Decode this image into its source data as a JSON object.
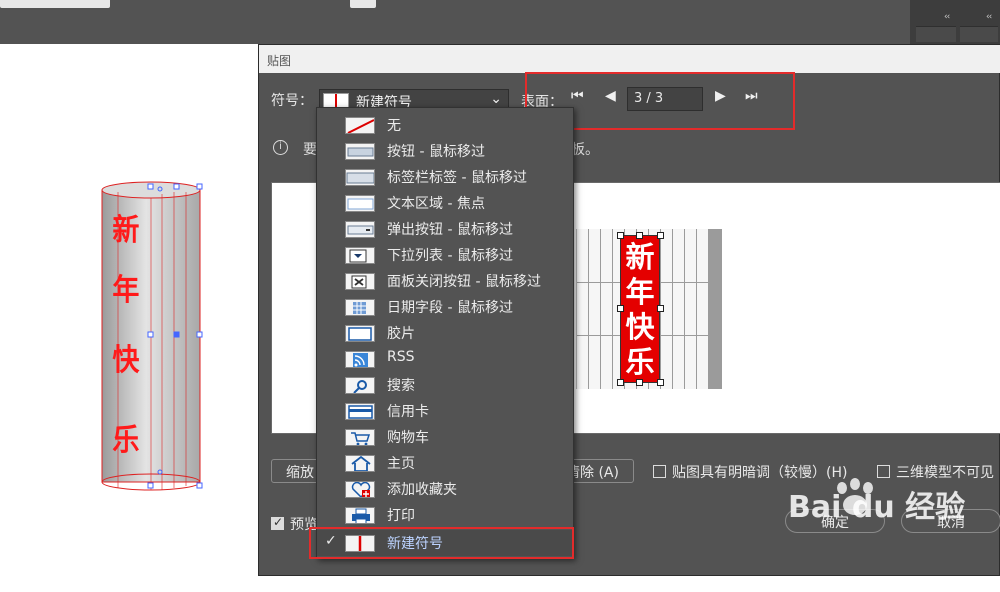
{
  "dialog": {
    "title": "贴图",
    "symbol_label": "符号：",
    "symbol_value": "新建符号",
    "surface_label": "表面：",
    "surface_value": "3 / 3",
    "info_text_start": "要",
    "info_text_end": "板。",
    "scale_button": "缩放",
    "clear_button": "清除 (A)",
    "shading_option": "贴图具有明暗调（较慢）(H)",
    "invisible_option": "三维模型不可见",
    "preview_option": "预览",
    "ok_button": "确定",
    "cancel_button": "取消"
  },
  "symbol_menu": {
    "items": [
      {
        "label": "无",
        "icon": "none-icon"
      },
      {
        "label": "按钮 - 鼠标移过",
        "icon": "button-icon"
      },
      {
        "label": "标签栏标签 - 鼠标移过",
        "icon": "tab-icon"
      },
      {
        "label": "文本区域 - 焦点",
        "icon": "text-area-icon"
      },
      {
        "label": "弹出按钮 - 鼠标移过",
        "icon": "popup-button-icon"
      },
      {
        "label": "下拉列表 - 鼠标移过",
        "icon": "dropdown-list-icon"
      },
      {
        "label": "面板关闭按钮 - 鼠标移过",
        "icon": "panel-close-icon"
      },
      {
        "label": "日期字段 - 鼠标移过",
        "icon": "date-field-icon"
      },
      {
        "label": "胶片",
        "icon": "film-icon"
      },
      {
        "label": "RSS",
        "icon": "rss-icon"
      },
      {
        "label": "搜索",
        "icon": "search-icon"
      },
      {
        "label": "信用卡",
        "icon": "credit-card-icon"
      },
      {
        "label": "购物车",
        "icon": "cart-icon"
      },
      {
        "label": "主页",
        "icon": "home-icon"
      },
      {
        "label": "添加收藏夹",
        "icon": "add-favorite-icon"
      },
      {
        "label": "打印",
        "icon": "print-icon"
      },
      {
        "label": "新建符号",
        "icon": "new-symbol-icon",
        "selected": true
      }
    ]
  },
  "artwork": {
    "text": "新年快乐",
    "accent_red": "#e40000"
  },
  "watermark": {
    "text": "Bai du 经验"
  }
}
